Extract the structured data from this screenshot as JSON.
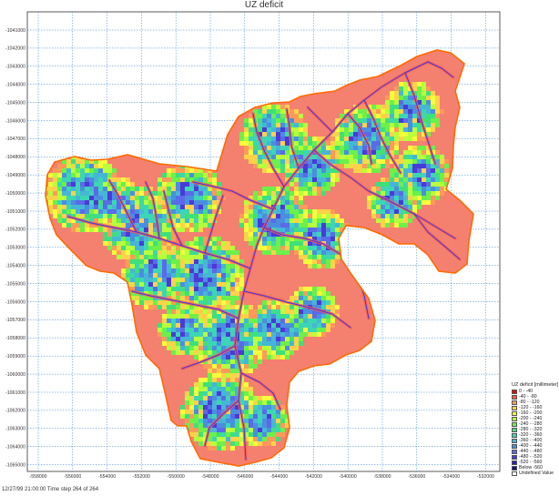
{
  "map": {
    "title": "UZ deficit",
    "y_tick_labels": [
      "-1041000",
      "-1042000",
      "-1043000",
      "-1044000",
      "-1045000",
      "-1046000",
      "-1047000",
      "-1048000",
      "-1049000",
      "-1050000",
      "-1051000",
      "-1052000",
      "-1053000",
      "-1054000",
      "-1055000",
      "-1056000",
      "-1057000",
      "-1058000",
      "-1059000",
      "-1060000",
      "-1061000",
      "-1062000",
      "-1063000",
      "-1064000",
      "-1065000"
    ],
    "x_tick_labels": [
      "-558000",
      "-556000",
      "-554000",
      "-552000",
      "-550000",
      "-548000",
      "-546000",
      "-544000",
      "-542000",
      "-540000",
      "-538000",
      "-536000",
      "-534000",
      "-532000"
    ],
    "footer": "12/27/99 21:00:00 Time step 264 of 264"
  },
  "legend": {
    "title": "UZ deficit [millimeter]",
    "items": [
      {
        "label": "0 - -40",
        "color": "#e60000"
      },
      {
        "label": "-40 - -80",
        "color": "#ff5a3a"
      },
      {
        "label": "-80 - -120",
        "color": "#ff9a5a"
      },
      {
        "label": "-120 - -160",
        "color": "#ffd24a"
      },
      {
        "label": "-160 - -200",
        "color": "#f6ff3c"
      },
      {
        "label": "-200 - -240",
        "color": "#b8ff3c"
      },
      {
        "label": "-240 - -280",
        "color": "#6cf04a"
      },
      {
        "label": "-280 - -320",
        "color": "#3fe07a"
      },
      {
        "label": "-320 - -360",
        "color": "#3cd6b4"
      },
      {
        "label": "-360 - -400",
        "color": "#46b6d6"
      },
      {
        "label": "-400 - -440",
        "color": "#4a8ee0"
      },
      {
        "label": "-440 - -480",
        "color": "#5a6ae8"
      },
      {
        "label": "-480 - -520",
        "color": "#4a3ad6"
      },
      {
        "label": "-520 - -560",
        "color": "#2a20b0"
      },
      {
        "label": "Below -560",
        "color": "#14107a"
      },
      {
        "label": "Undefined Value",
        "color": "#ffffff"
      }
    ]
  },
  "colors": {
    "background_fill": "#f48070",
    "river": "#3a3ae8",
    "grid": "#2f7fd6",
    "boundary": "#ff6a00"
  }
}
